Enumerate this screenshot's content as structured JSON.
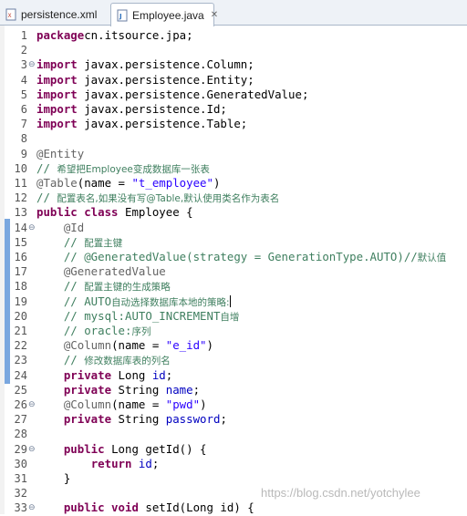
{
  "tabs": [
    {
      "label": "persistence.xml",
      "active": false
    },
    {
      "label": "Employee.java",
      "active": true,
      "close": "✕"
    }
  ],
  "lines": [
    {
      "n": "1",
      "fold": "",
      "segs": [
        [
          "k",
          "package"
        ],
        [
          "",
          "cn.itsource.jpa;"
        ]
      ]
    },
    {
      "n": "2",
      "fold": "",
      "segs": []
    },
    {
      "n": "3",
      "fold": "⊖",
      "segs": [
        [
          "k",
          "import"
        ],
        [
          "",
          " javax.persistence.Column;"
        ]
      ]
    },
    {
      "n": "4",
      "fold": "",
      "segs": [
        [
          "k",
          "import"
        ],
        [
          "",
          " javax.persistence.Entity;"
        ]
      ]
    },
    {
      "n": "5",
      "fold": "",
      "segs": [
        [
          "k",
          "import"
        ],
        [
          "",
          " javax.persistence.GeneratedValue;"
        ]
      ]
    },
    {
      "n": "6",
      "fold": "",
      "segs": [
        [
          "k",
          "import"
        ],
        [
          "",
          " javax.persistence.Id;"
        ]
      ]
    },
    {
      "n": "7",
      "fold": "",
      "segs": [
        [
          "k",
          "import"
        ],
        [
          "",
          " javax.persistence.Table;"
        ]
      ]
    },
    {
      "n": "8",
      "fold": "",
      "segs": []
    },
    {
      "n": "9",
      "fold": "",
      "segs": [
        [
          "a",
          "@Entity"
        ]
      ]
    },
    {
      "n": "10",
      "fold": "",
      "segs": [
        [
          "c",
          "// "
        ],
        [
          "c cjk",
          "希望把Employee变成数据库一张表"
        ]
      ]
    },
    {
      "n": "11",
      "fold": "",
      "segs": [
        [
          "a",
          "@Table"
        ],
        [
          "",
          "(name = "
        ],
        [
          "s",
          "\"t_employee\""
        ],
        [
          "",
          ")"
        ]
      ]
    },
    {
      "n": "12",
      "fold": "",
      "segs": [
        [
          "c",
          "// "
        ],
        [
          "c cjk",
          "配置表名,如果没有写@Table,默认使用类名作为表名"
        ]
      ]
    },
    {
      "n": "13",
      "fold": "",
      "segs": [
        [
          "k",
          "public class"
        ],
        [
          "",
          " Employee {"
        ]
      ]
    },
    {
      "n": "14",
      "fold": "⊖",
      "segs": [
        [
          "",
          "    "
        ],
        [
          "a",
          "@Id"
        ]
      ]
    },
    {
      "n": "15",
      "fold": "",
      "segs": [
        [
          "",
          "    "
        ],
        [
          "c",
          "// "
        ],
        [
          "c cjk",
          "配置主键"
        ]
      ]
    },
    {
      "n": "16",
      "fold": "",
      "segs": [
        [
          "",
          "    "
        ],
        [
          "c",
          "// @GeneratedValue(strategy = GenerationType.AUTO)//"
        ],
        [
          "c cjk",
          "默认值"
        ]
      ]
    },
    {
      "n": "17",
      "fold": "",
      "segs": [
        [
          "",
          "    "
        ],
        [
          "a",
          "@GeneratedValue"
        ]
      ]
    },
    {
      "n": "18",
      "fold": "",
      "segs": [
        [
          "",
          "    "
        ],
        [
          "c",
          "// "
        ],
        [
          "c cjk",
          "配置主键的生成策略"
        ]
      ]
    },
    {
      "n": "19",
      "fold": "",
      "segs": [
        [
          "",
          "    "
        ],
        [
          "c",
          "// AUTO"
        ],
        [
          "c cjk",
          "自动选择数据库本地的策略:"
        ],
        [
          "caret",
          ""
        ]
      ]
    },
    {
      "n": "20",
      "fold": "",
      "segs": [
        [
          "",
          "    "
        ],
        [
          "c",
          "// mysql:AUTO_INCREMENT"
        ],
        [
          "c cjk",
          "自增"
        ]
      ]
    },
    {
      "n": "21",
      "fold": "",
      "segs": [
        [
          "",
          "    "
        ],
        [
          "c",
          "// oracle:"
        ],
        [
          "c cjk",
          "序列"
        ]
      ]
    },
    {
      "n": "22",
      "fold": "",
      "segs": [
        [
          "",
          "    "
        ],
        [
          "a",
          "@Column"
        ],
        [
          "",
          "(name = "
        ],
        [
          "s",
          "\"e_id\""
        ],
        [
          "",
          ")"
        ]
      ]
    },
    {
      "n": "23",
      "fold": "",
      "segs": [
        [
          "",
          "    "
        ],
        [
          "c",
          "// "
        ],
        [
          "c cjk",
          "修改数据库表的列名"
        ]
      ]
    },
    {
      "n": "24",
      "fold": "",
      "segs": [
        [
          "",
          "    "
        ],
        [
          "k",
          "private"
        ],
        [
          "",
          " Long "
        ],
        [
          "f",
          "id"
        ],
        [
          "",
          ";"
        ]
      ]
    },
    {
      "n": "25",
      "fold": "",
      "segs": [
        [
          "",
          "    "
        ],
        [
          "k",
          "private"
        ],
        [
          "",
          " String "
        ],
        [
          "f",
          "name"
        ],
        [
          "",
          ";"
        ]
      ]
    },
    {
      "n": "26",
      "fold": "⊖",
      "segs": [
        [
          "",
          "    "
        ],
        [
          "a",
          "@Column"
        ],
        [
          "",
          "(name = "
        ],
        [
          "s",
          "\"pwd\""
        ],
        [
          "",
          ")"
        ]
      ]
    },
    {
      "n": "27",
      "fold": "",
      "segs": [
        [
          "",
          "    "
        ],
        [
          "k",
          "private"
        ],
        [
          "",
          " String "
        ],
        [
          "f",
          "password"
        ],
        [
          "",
          ";"
        ]
      ]
    },
    {
      "n": "28",
      "fold": "",
      "segs": []
    },
    {
      "n": "29",
      "fold": "⊖",
      "segs": [
        [
          "",
          "    "
        ],
        [
          "k",
          "public"
        ],
        [
          "",
          " Long getId() {"
        ]
      ]
    },
    {
      "n": "30",
      "fold": "",
      "segs": [
        [
          "",
          "        "
        ],
        [
          "k",
          "return"
        ],
        [
          "",
          " "
        ],
        [
          "f",
          "id"
        ],
        [
          "",
          ";"
        ]
      ]
    },
    {
      "n": "31",
      "fold": "",
      "segs": [
        [
          "",
          "    }"
        ]
      ]
    },
    {
      "n": "32",
      "fold": "",
      "segs": []
    },
    {
      "n": "33",
      "fold": "⊖",
      "segs": [
        [
          "",
          "    "
        ],
        [
          "k",
          "public void"
        ],
        [
          "",
          " setId(Long id) {"
        ]
      ]
    }
  ],
  "watermark": "https://blog.csdn.net/yotchylee",
  "colors": {
    "keyword": "#7f0055",
    "annotation": "#646464",
    "comment": "#3f7f5f",
    "string": "#2a00ff",
    "field": "#0000c0",
    "change_bar": "#7aa7df"
  }
}
